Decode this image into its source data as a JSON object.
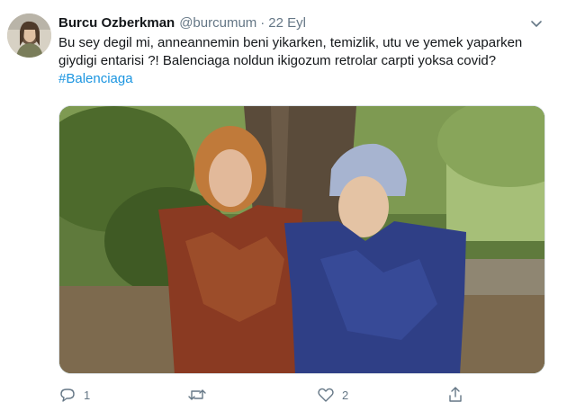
{
  "tweet": {
    "author_name": "Burcu Ozberkman",
    "handle": "@burcumum",
    "separator": "·",
    "date": "22 Eyl",
    "text_line_1": "Bu sey degil mi, anneannemin beni yikarken, temizlik, utu ve yemek yaparken",
    "text_line_2": "giydigi entarisi ?! Balenciaga noldun ikigozum retrolar carpti yoksa covid?",
    "hashtag": "#Balenciaga"
  },
  "actions": {
    "reply_count": "1",
    "retweet_count": "",
    "like_count": "2"
  },
  "icons": {
    "menu": "chevron-down-icon",
    "reply": "reply-icon",
    "retweet": "retweet-icon",
    "like": "heart-icon",
    "share": "share-icon"
  },
  "colors": {
    "link": "#1b95e0",
    "secondary_text": "#657786",
    "primary_text": "#14171a"
  }
}
